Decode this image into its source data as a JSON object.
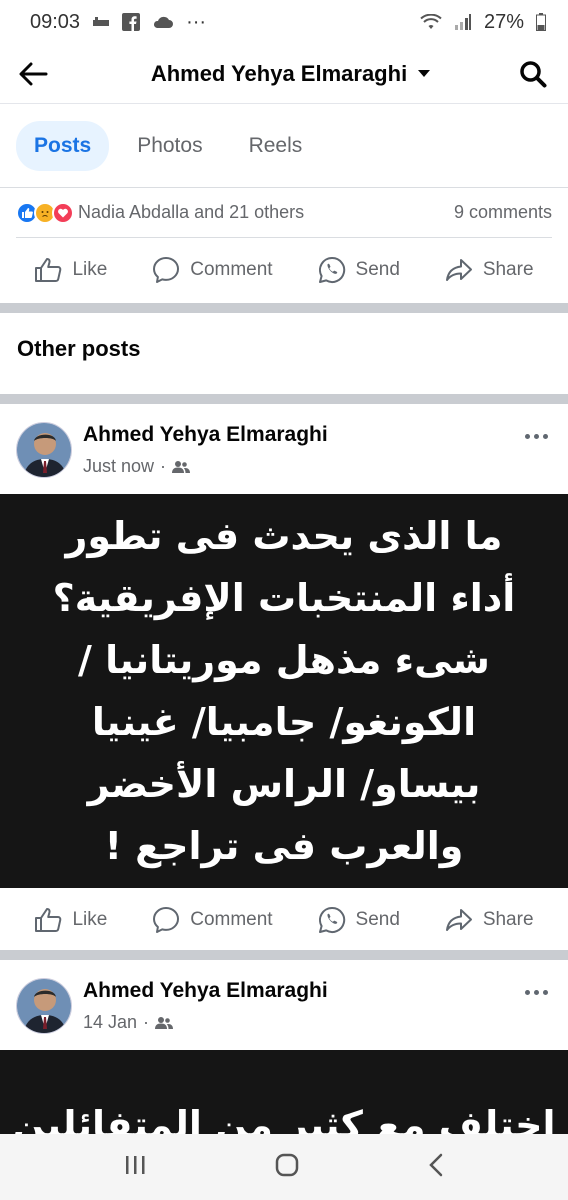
{
  "status_bar": {
    "time": "09:03",
    "battery": "27%"
  },
  "header": {
    "title": "Ahmed Yehya Elmaraghi"
  },
  "tabs": [
    {
      "label": "Posts",
      "active": true
    },
    {
      "label": "Photos",
      "active": false
    },
    {
      "label": "Reels",
      "active": false
    }
  ],
  "reactions": {
    "summary": "Nadia Abdalla and 21 others",
    "comments": "9 comments"
  },
  "actions": {
    "like": "Like",
    "comment": "Comment",
    "send": "Send",
    "share": "Share"
  },
  "other_posts_heading": "Other posts",
  "posts": [
    {
      "author": "Ahmed Yehya Elmaraghi",
      "time": "Just now",
      "text": "ما الذى يحدث فى تطور أداء المنتخبات الإفريقية؟ شىء مذهل موريتانيا / الكونغو/ جامبيا/ غينيا بيساو/ الراس الأخضر والعرب فى تراجع !"
    },
    {
      "author": "Ahmed Yehya Elmaraghi",
      "time": "14 Jan",
      "text": "اختلف مع كثير من المتفائلين"
    }
  ],
  "colors": {
    "accent": "#1b74e4",
    "tab_active_bg": "#e7f3ff",
    "post_bg": "#151515"
  }
}
